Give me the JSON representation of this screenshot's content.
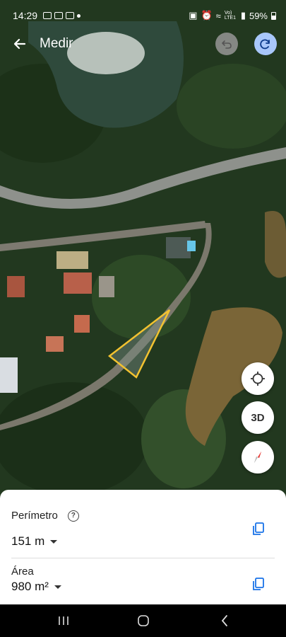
{
  "status_bar": {
    "time": "14:29",
    "network_text": "Vo) LTE1",
    "battery": "59%"
  },
  "app_bar": {
    "title": "Medir",
    "back_icon": "arrow-left-icon",
    "undo_icon": "undo-icon",
    "redo_icon": "redo-icon"
  },
  "map_controls": {
    "location_icon": "my-location-icon",
    "three_d_label": "3D",
    "compass_icon": "compass-icon"
  },
  "measurement": {
    "perimeter_label": "Perímetro",
    "perimeter_value": "151 m",
    "area_label": "Área",
    "area_value": "980 m²",
    "help_icon": "help-icon",
    "copy_icon": "copy-icon"
  },
  "colors": {
    "polygon_outline": "#f2c230",
    "accent": "#1a73e8",
    "redo_bg": "#a8c7fa"
  },
  "nav_bar": {
    "recents_icon": "recents-icon",
    "home_icon": "home-icon",
    "back_icon": "back-chevron-icon"
  }
}
